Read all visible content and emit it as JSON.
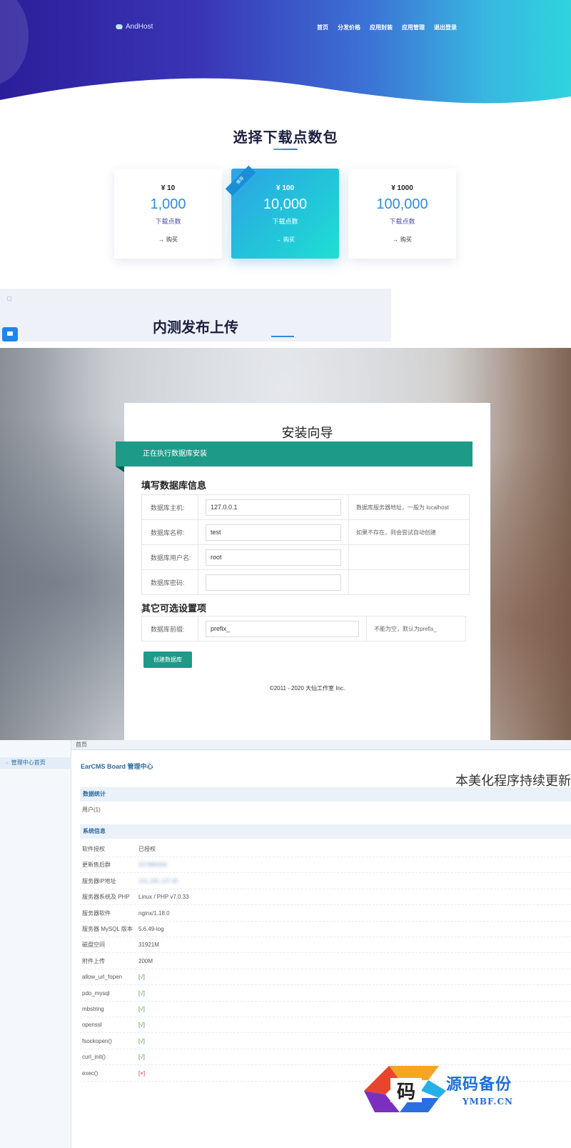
{
  "hero": {
    "logo_text": "AndHost",
    "nav": [
      "首页",
      "分发价格",
      "应用封装",
      "应用管理",
      "退出登录"
    ]
  },
  "packages": {
    "title": "选择下载点数包",
    "items": [
      {
        "price": "¥ 10",
        "points": "1,000",
        "unit": "下载点数",
        "buy": "购买"
      },
      {
        "price": "¥ 100",
        "points": "10,000",
        "unit": "下载点数",
        "buy": "购买",
        "featured": true
      },
      {
        "price": "¥ 1000",
        "points": "100,000",
        "unit": "下载点数",
        "buy": "购买"
      }
    ],
    "ribbon": "推荐"
  },
  "beta": {
    "title": "内测发布上传"
  },
  "install": {
    "title": "安装向导",
    "banner": "正在执行数据库安装",
    "db_heading": "填写数据库信息",
    "fields": [
      {
        "label": "数据库主机:",
        "value": "127.0.0.1",
        "hint": "数据库服务器地址，一般为 localhost"
      },
      {
        "label": "数据库名称:",
        "value": "test",
        "hint": "如果不存在，则会尝试自动创建"
      },
      {
        "label": "数据库用户名:",
        "value": "root",
        "hint": ""
      },
      {
        "label": "数据库密码:",
        "value": "",
        "hint": ""
      }
    ],
    "optional_heading": "其它可选设置项",
    "prefix": {
      "label": "数据库前缀:",
      "value": "prefix_",
      "hint": "不能为空，默认为prefix_"
    },
    "create_button": "创建数据库",
    "copyright": "©2011 - 2020 大仙工作室 Inc."
  },
  "cms": {
    "topbar": "首页",
    "sidebar_item": "管理中心首页",
    "title": "EarCMS Board 管理中心",
    "banner": "本美化程序持续更新",
    "stats_heading": "数据统计",
    "users": "用户(1)",
    "sys_heading": "系统信息",
    "rows": [
      {
        "k": "软件授权",
        "v": "已授权",
        "style": "normal"
      },
      {
        "k": "更新售后群",
        "v": "327880000",
        "style": "blurred"
      },
      {
        "k": "服务器IP地址",
        "v": "101.245.137.40",
        "style": "blurred"
      },
      {
        "k": "服务器系统及 PHP",
        "v": "Linux / PHP v7.0.33",
        "style": "normal"
      },
      {
        "k": "服务器软件",
        "v": "nginx/1.18.0",
        "style": "normal"
      },
      {
        "k": "服务器 MySQL 版本",
        "v": "5.6.49-log",
        "style": "normal"
      },
      {
        "k": "磁盘空间",
        "v": "31921M",
        "style": "normal"
      },
      {
        "k": "附件上传",
        "v": "200M",
        "style": "normal"
      },
      {
        "k": "allow_url_fopen",
        "v": "[√]",
        "style": "ok"
      },
      {
        "k": "pdo_mysql",
        "v": "[√]",
        "style": "ok"
      },
      {
        "k": "mbstring",
        "v": "[√]",
        "style": "ok"
      },
      {
        "k": "openssl",
        "v": "[√]",
        "style": "ok"
      },
      {
        "k": "fsockopen()",
        "v": "[√]",
        "style": "ok"
      },
      {
        "k": "curl_init()",
        "v": "[√]",
        "style": "ok"
      },
      {
        "k": "exec()",
        "v": "[×]",
        "style": "bad"
      }
    ]
  },
  "watermark": {
    "title": "源码备份",
    "sub": "YMBF.CN",
    "glyph": "码"
  }
}
